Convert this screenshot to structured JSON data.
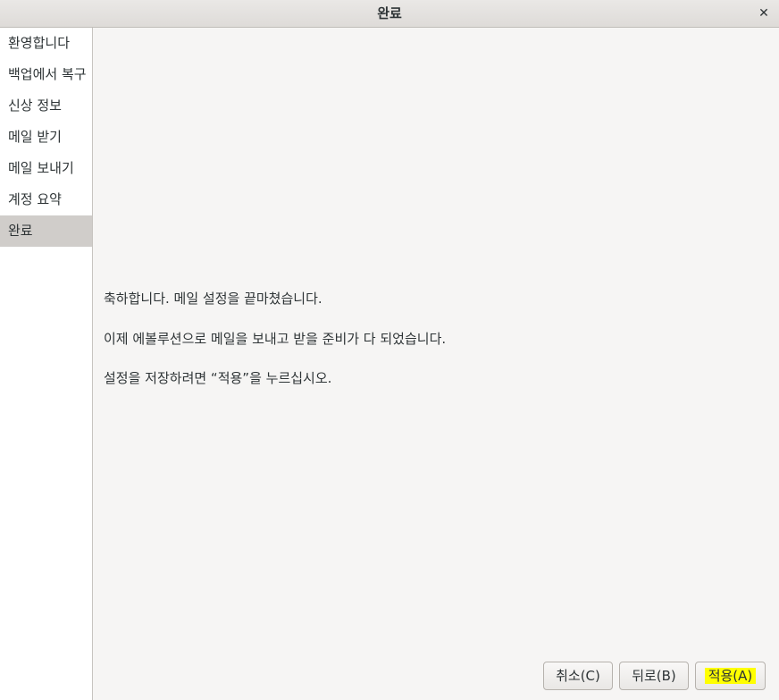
{
  "window": {
    "title": "완료",
    "close_glyph": "✕"
  },
  "sidebar": {
    "items": [
      {
        "label": "환영합니다"
      },
      {
        "label": "백업에서 복구"
      },
      {
        "label": "신상 정보"
      },
      {
        "label": "메일 받기"
      },
      {
        "label": "메일 보내기"
      },
      {
        "label": "계정 요약"
      },
      {
        "label": "완료"
      }
    ],
    "selected_index": 6
  },
  "main": {
    "line1": "축하합니다.  메일 설정을 끝마쳤습니다.",
    "line2": "이제 에볼루션으로 메일을 보내고 받을 준비가 다 되었습니다.",
    "line3": "설정을 저장하려면 “적용”을 누르십시오."
  },
  "buttons": {
    "cancel": "취소(C)",
    "back": "뒤로(B)",
    "apply": "적용(A)"
  },
  "colors": {
    "highlight": "#ffff00",
    "selected_bg": "#d0cdca"
  }
}
